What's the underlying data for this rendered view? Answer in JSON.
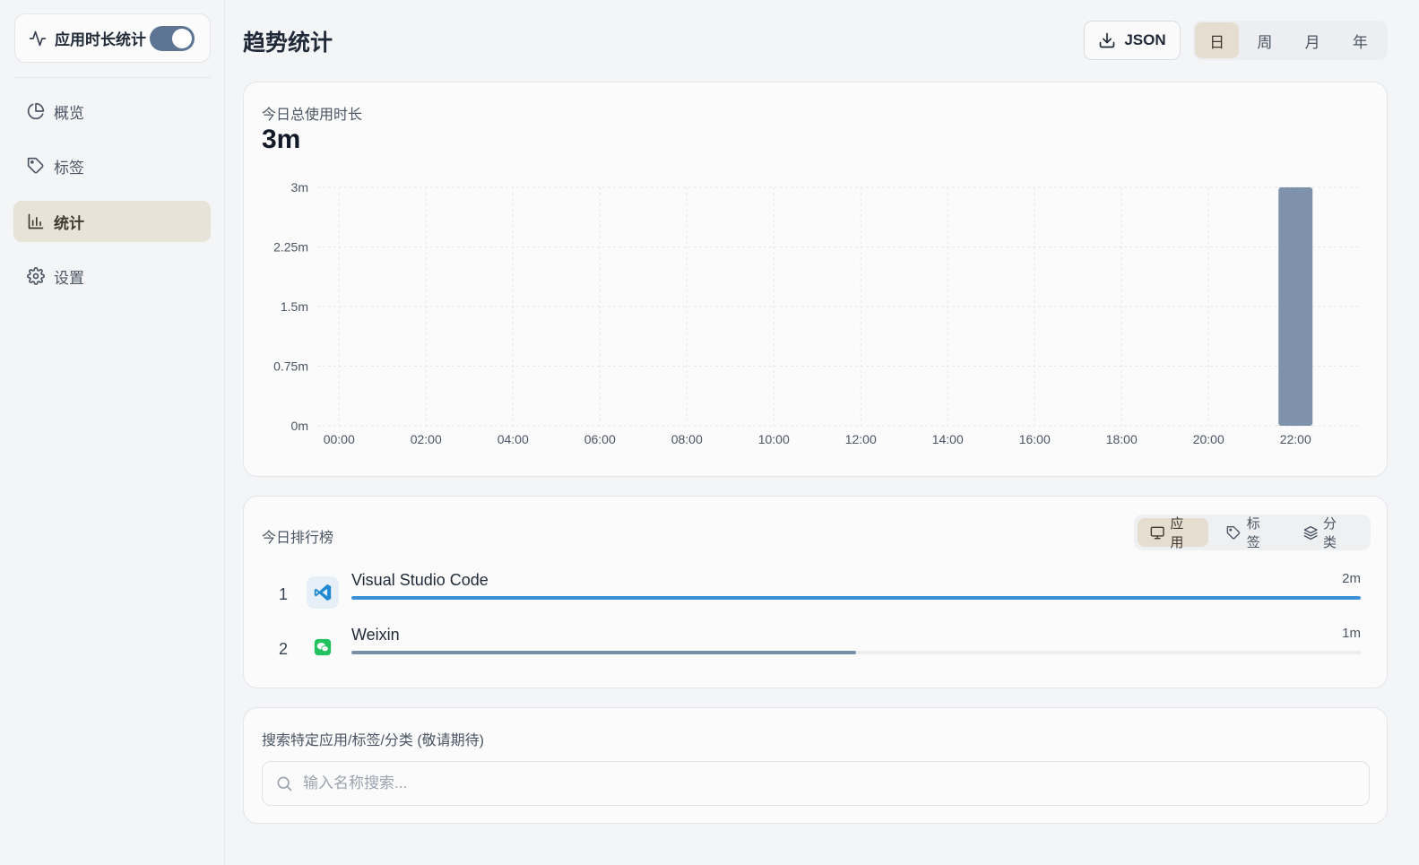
{
  "sidebar": {
    "app_title": "应用时长统计",
    "toggle_on": true,
    "items": [
      {
        "label": "概览",
        "icon": "pie-chart-icon",
        "active": false
      },
      {
        "label": "标签",
        "icon": "tag-icon",
        "active": false
      },
      {
        "label": "统计",
        "icon": "bar-chart-icon",
        "active": true
      },
      {
        "label": "设置",
        "icon": "gear-icon",
        "active": false
      }
    ]
  },
  "header": {
    "title": "趋势统计",
    "export_label": "JSON",
    "range_tabs": [
      "日",
      "周",
      "月",
      "年"
    ],
    "active_range": "日"
  },
  "summary": {
    "label": "今日总使用时长",
    "value": "3m"
  },
  "chart_data": {
    "type": "bar",
    "title": "",
    "xlabel": "",
    "ylabel": "",
    "x_tick_labels": [
      "00:00",
      "02:00",
      "04:00",
      "06:00",
      "08:00",
      "10:00",
      "12:00",
      "14:00",
      "16:00",
      "18:00",
      "20:00",
      "22:00"
    ],
    "y_tick_labels": [
      "0m",
      "0.75m",
      "1.5m",
      "2.25m",
      "3m"
    ],
    "ylim": [
      0,
      3
    ],
    "unit": "minutes",
    "grid": true,
    "bar_color": "#7e93ab",
    "categories": [
      "00:00",
      "01:00",
      "02:00",
      "03:00",
      "04:00",
      "05:00",
      "06:00",
      "07:00",
      "08:00",
      "09:00",
      "10:00",
      "11:00",
      "12:00",
      "13:00",
      "14:00",
      "15:00",
      "16:00",
      "17:00",
      "18:00",
      "19:00",
      "20:00",
      "21:00",
      "22:00",
      "23:00"
    ],
    "values": [
      0,
      0,
      0,
      0,
      0,
      0,
      0,
      0,
      0,
      0,
      0,
      0,
      0,
      0,
      0,
      0,
      0,
      0,
      0,
      0,
      0,
      0,
      3,
      0
    ]
  },
  "ranking": {
    "title": "今日排行榜",
    "tabs": [
      {
        "label": "应用",
        "icon": "monitor-icon",
        "active": true
      },
      {
        "label": "标签",
        "icon": "tag-icon",
        "active": false
      },
      {
        "label": "分类",
        "icon": "layers-icon",
        "active": false
      }
    ],
    "items": [
      {
        "rank": "1",
        "name": "Visual Studio Code",
        "time": "2m",
        "share": 1.0,
        "color": "#3a8fd6",
        "icon": "vscode-icon"
      },
      {
        "rank": "2",
        "name": "Weixin",
        "time": "1m",
        "share": 0.5,
        "color": "#7891a9",
        "icon": "wechat-icon"
      }
    ]
  },
  "search": {
    "title": "搜索特定应用/标签/分类 (敬请期待)",
    "placeholder": "输入名称搜索..."
  }
}
